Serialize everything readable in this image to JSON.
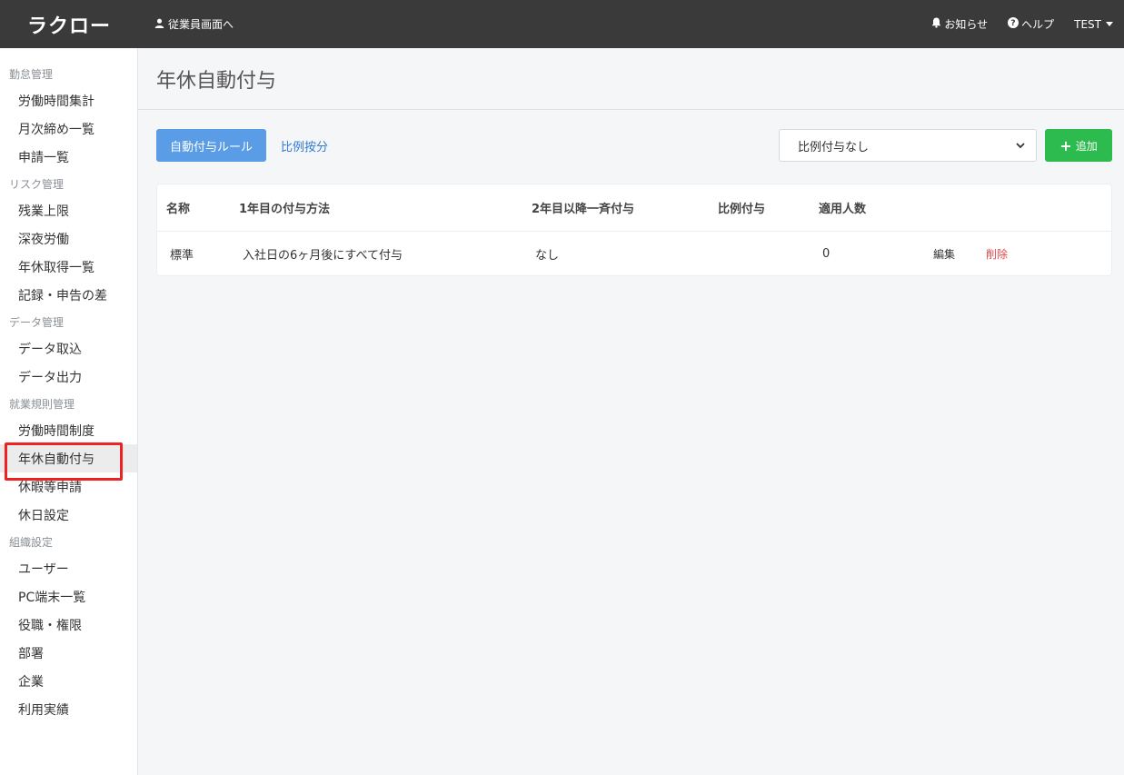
{
  "topbar": {
    "logo": "ラクロー",
    "employee_link": "従業員画面へ",
    "notifications": "お知らせ",
    "help": "ヘルプ",
    "user": "TEST"
  },
  "sidebar": {
    "sections": [
      {
        "title": "勤怠管理",
        "items": [
          "労働時間集計",
          "月次締め一覧",
          "申請一覧"
        ]
      },
      {
        "title": "リスク管理",
        "items": [
          "残業上限",
          "深夜労働",
          "年休取得一覧",
          "記録・申告の差"
        ]
      },
      {
        "title": "データ管理",
        "items": [
          "データ取込",
          "データ出力"
        ]
      },
      {
        "title": "就業規則管理",
        "items": [
          "労働時間制度",
          "年休自動付与",
          "休暇等申請",
          "休日設定"
        ]
      },
      {
        "title": "組織設定",
        "items": [
          "ユーザー",
          "PC端末一覧",
          "役職・権限",
          "部署",
          "企業",
          "利用実績"
        ]
      }
    ],
    "active_item": "年休自動付与"
  },
  "page": {
    "title": "年休自動付与",
    "rule_button": "自動付与ルール",
    "proportional_link": "比例按分",
    "select_value": "比例付与なし",
    "add_button": "追加"
  },
  "table": {
    "headers": [
      "名称",
      "1年目の付与方法",
      "2年目以降一斉付与",
      "比例付与",
      "適用人数"
    ],
    "rows": [
      {
        "name": "標準",
        "first_year": "入社日の6ヶ月後にすべて付与",
        "second_year": "なし",
        "proportional": "",
        "count": "0",
        "edit": "編集",
        "delete": "削除"
      }
    ]
  }
}
